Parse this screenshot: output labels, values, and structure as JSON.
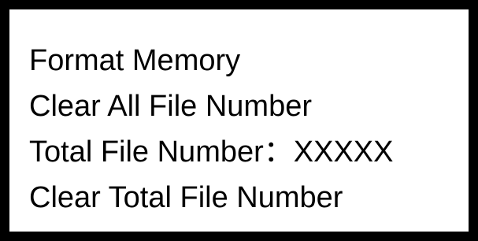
{
  "menu": {
    "items": [
      {
        "label": "Format Memory"
      },
      {
        "label": "Clear All File Number"
      },
      {
        "label": "Total File Number：XXXXX"
      },
      {
        "label": "Clear Total File Number"
      }
    ]
  }
}
